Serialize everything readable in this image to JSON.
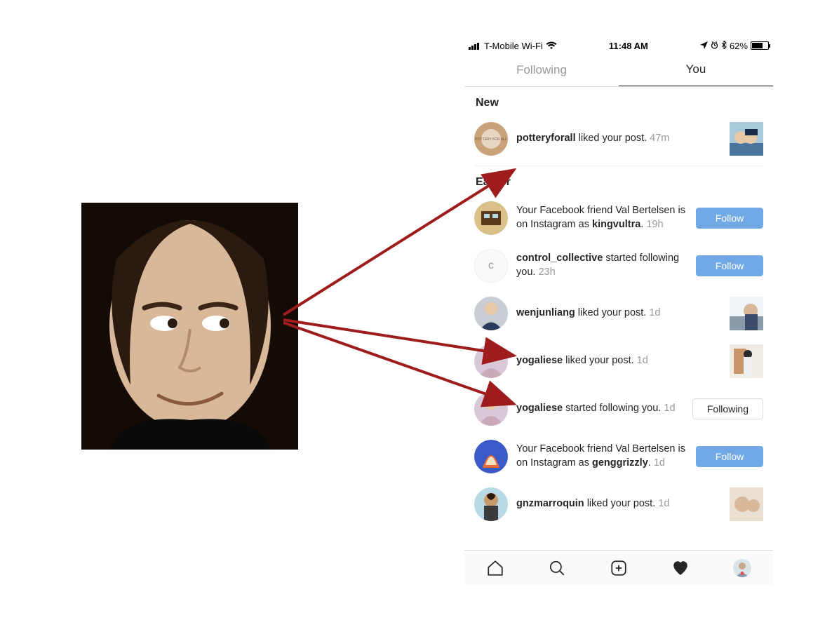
{
  "statusbar": {
    "carrier": "T-Mobile Wi-Fi",
    "time": "11:48 AM",
    "battery_pct": "62%"
  },
  "tabs": {
    "following": "Following",
    "you": "You"
  },
  "sections": {
    "new_header": "New",
    "earlier_header": "Earlier"
  },
  "buttons": {
    "follow": "Follow",
    "following": "Following"
  },
  "activity": {
    "new": [
      {
        "user": "potteryforall",
        "text": " liked your post. ",
        "time": "47m"
      }
    ],
    "earlier": [
      {
        "prefix": "Your Facebook friend Val Bertelsen is on Instagram as ",
        "user": "kingvultra",
        "suffix": ". ",
        "time": "19h"
      },
      {
        "user": "control_collective",
        "text": " started following you. ",
        "time": "23h",
        "avatar_letter": "c"
      },
      {
        "user": "wenjunliang",
        "text": " liked your post. ",
        "time": "1d"
      },
      {
        "user": "yogaliese",
        "text": " liked your post. ",
        "time": "1d"
      },
      {
        "user": "yogaliese",
        "text": " started following you. ",
        "time": "1d"
      },
      {
        "prefix": "Your Facebook friend Val Bertelsen is on Instagram as ",
        "user": "genggrizzly",
        "suffix": ". ",
        "time": "1d"
      },
      {
        "user": "gnzmarroquin",
        "text": " liked your post. ",
        "time": "1d"
      }
    ]
  }
}
